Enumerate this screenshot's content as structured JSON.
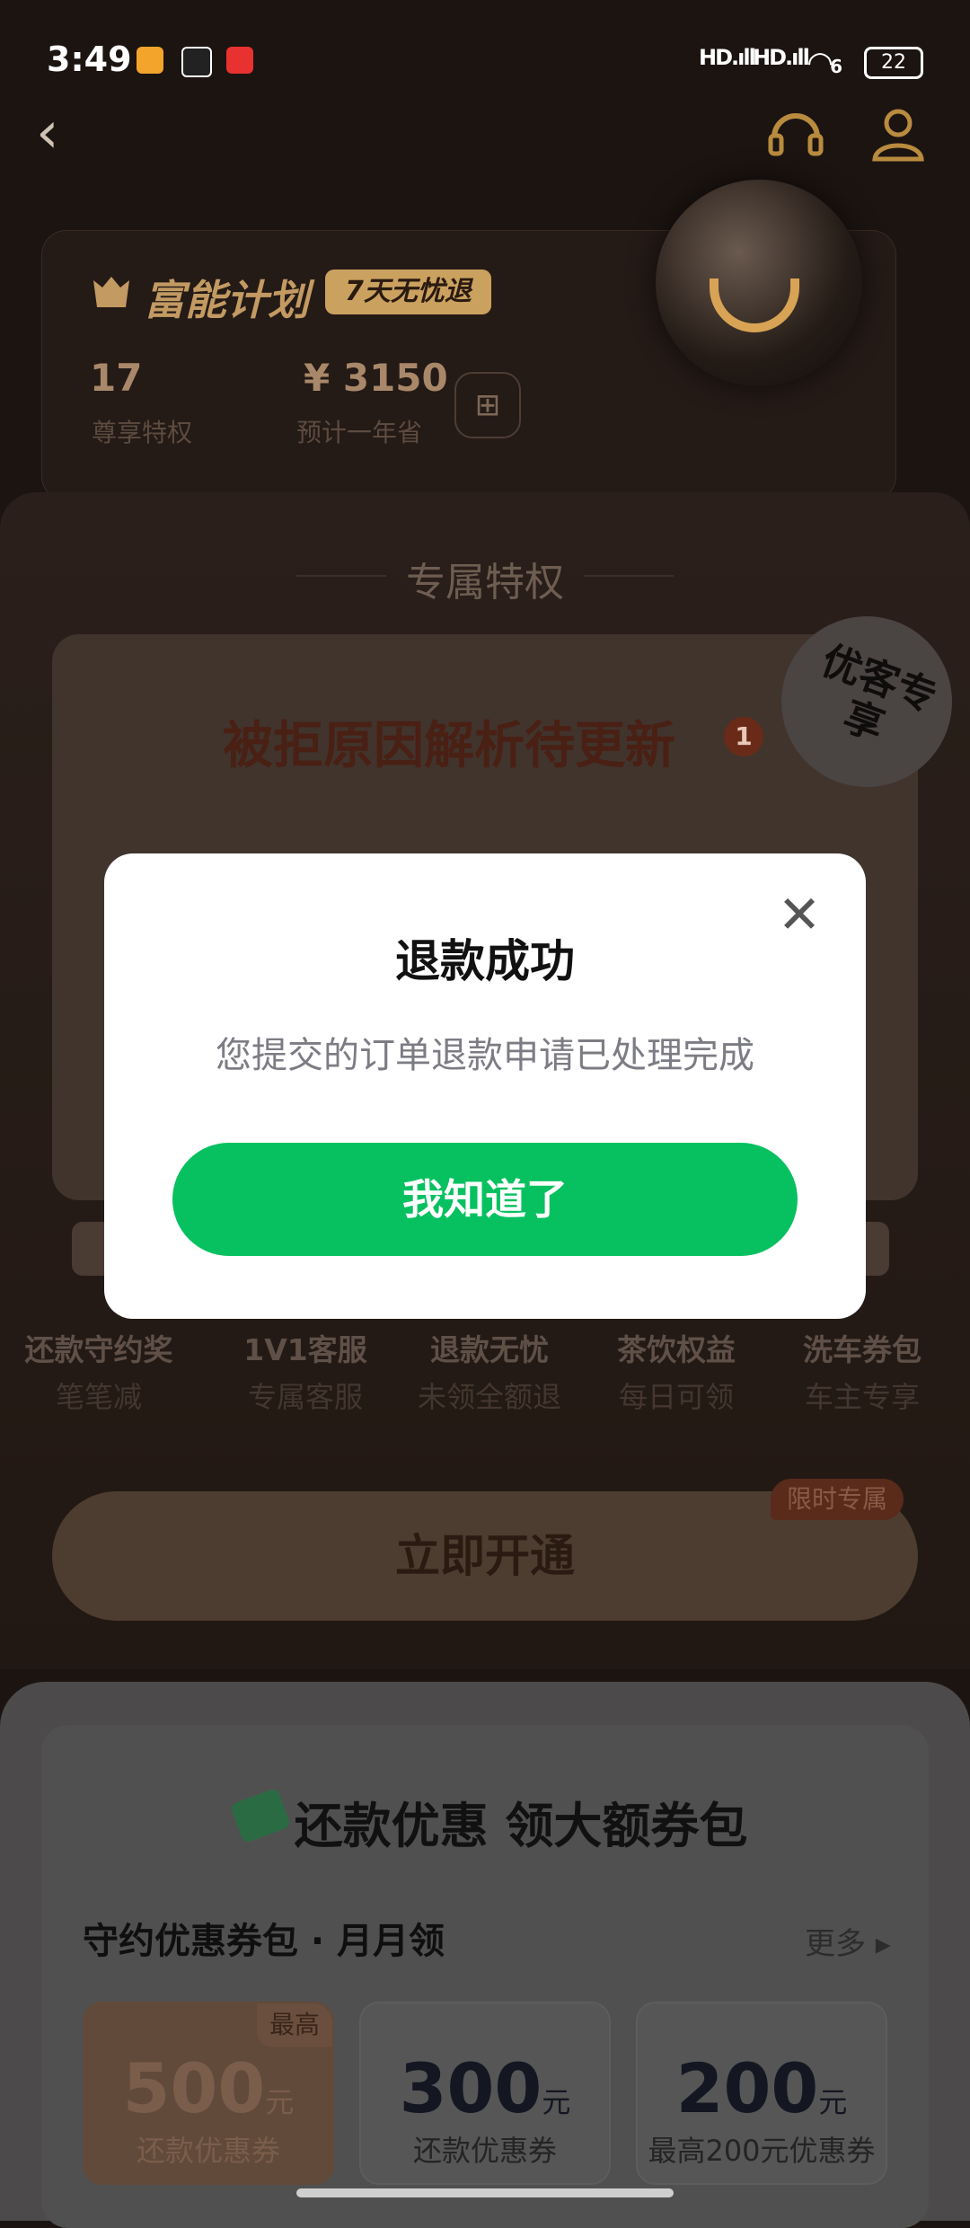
{
  "status_bar": {
    "time": "3:49",
    "signal1": "HD.ıll",
    "signal2": "HD.ıll",
    "wifi": "6",
    "battery": "22"
  },
  "nav": {
    "back_glyph": "‹",
    "service_icon": "headset-icon",
    "profile_icon": "user-icon"
  },
  "plan": {
    "title": "富能计划",
    "tag": "7天无忧退",
    "stats": [
      {
        "value": "17",
        "label": "尊享特权"
      },
      {
        "value": "¥ 3150",
        "label": "预计一年省"
      }
    ]
  },
  "privileges": {
    "section_title": "专属特权",
    "reason_title": "被拒原因解析待更新",
    "reason_badge": "1",
    "sticker": "优客专享"
  },
  "benefits": [
    {
      "title": "还款守约奖",
      "sub": "笔笔减"
    },
    {
      "title": "1V1客服",
      "sub": "专属客服"
    },
    {
      "title": "退款无忧",
      "sub": "未领全额退"
    },
    {
      "title": "茶饮权益",
      "sub": "每日可领"
    },
    {
      "title": "洗车券包",
      "sub": "车主专享"
    }
  ],
  "open_button": {
    "label": "立即开通",
    "tag": "限时专属"
  },
  "promo": {
    "title": "还款优惠 领大额券包",
    "pack_title": "守约优惠券包 · 月月领",
    "more": "更多 ▸",
    "coupons": [
      {
        "value": "500",
        "unit": "元",
        "label": "还款优惠券",
        "tag": "最高"
      },
      {
        "value": "300",
        "unit": "元",
        "label": "还款优惠券"
      },
      {
        "value": "200",
        "unit": "元",
        "label": "最高200元优惠券"
      }
    ]
  },
  "modal": {
    "title": "退款成功",
    "message": "您提交的订单退款申请已处理完成",
    "button": "我知道了",
    "close_glyph": "✕"
  },
  "colors": {
    "accent_green": "#07c160",
    "gold": "#c29a62"
  }
}
